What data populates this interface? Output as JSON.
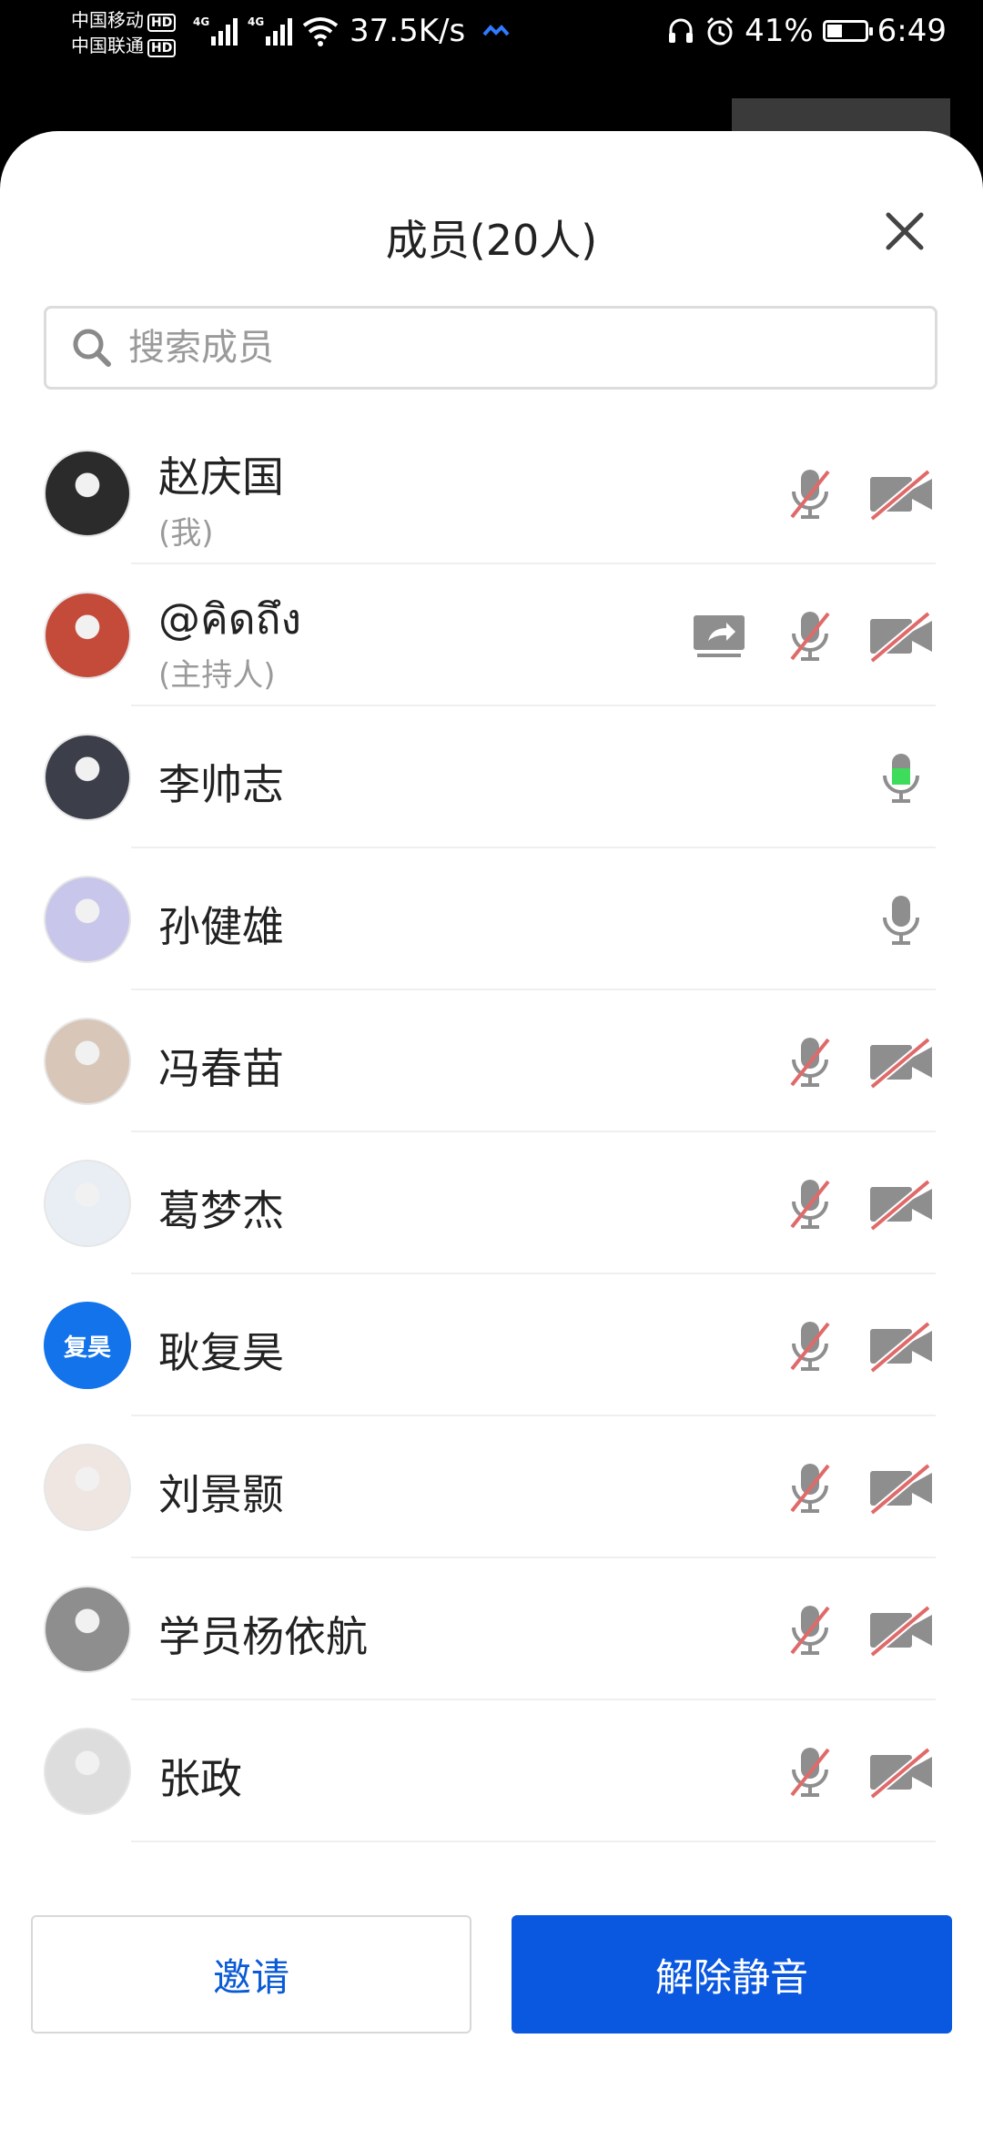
{
  "status_bar": {
    "carrier1": "中国移动",
    "carrier2": "中国联通",
    "hd": "HD",
    "net": "4G",
    "speed": "37.5K/s",
    "battery": "41%",
    "battery_level": 0.41,
    "time": "6:49"
  },
  "sheet": {
    "title": "成员(20人)",
    "search_placeholder": "搜索成员"
  },
  "members": [
    {
      "name": "赵庆国",
      "role": "(我)",
      "mic": "muted",
      "camera": "off",
      "share": false
    },
    {
      "name": "@คิดถึง",
      "role": "(主持人)",
      "mic": "muted",
      "camera": "off",
      "share": true
    },
    {
      "name": "李帅志",
      "role": "",
      "mic": "speaking",
      "camera": "none",
      "share": false
    },
    {
      "name": "孙健雄",
      "role": "",
      "mic": "on",
      "camera": "none",
      "share": false
    },
    {
      "name": "冯春苗",
      "role": "",
      "mic": "muted",
      "camera": "off",
      "share": false
    },
    {
      "name": "葛梦杰",
      "role": "",
      "mic": "muted",
      "camera": "off",
      "share": false
    },
    {
      "name": "耿复昊",
      "role": "",
      "mic": "muted",
      "camera": "off",
      "share": false,
      "avatar_text": "复昊"
    },
    {
      "name": "刘景颢",
      "role": "",
      "mic": "muted",
      "camera": "off",
      "share": false
    },
    {
      "name": "学员杨依航",
      "role": "",
      "mic": "muted",
      "camera": "off",
      "share": false
    },
    {
      "name": "张政",
      "role": "",
      "mic": "muted",
      "camera": "off",
      "share": false
    }
  ],
  "buttons": {
    "invite": "邀请",
    "unmute": "解除静音"
  },
  "colors": {
    "primary": "#0a57e0",
    "link": "#0a5ad6",
    "mute_slash": "#e06a6a",
    "speaking": "#3ddc5a",
    "icon_gray": "#8e8e8e"
  }
}
